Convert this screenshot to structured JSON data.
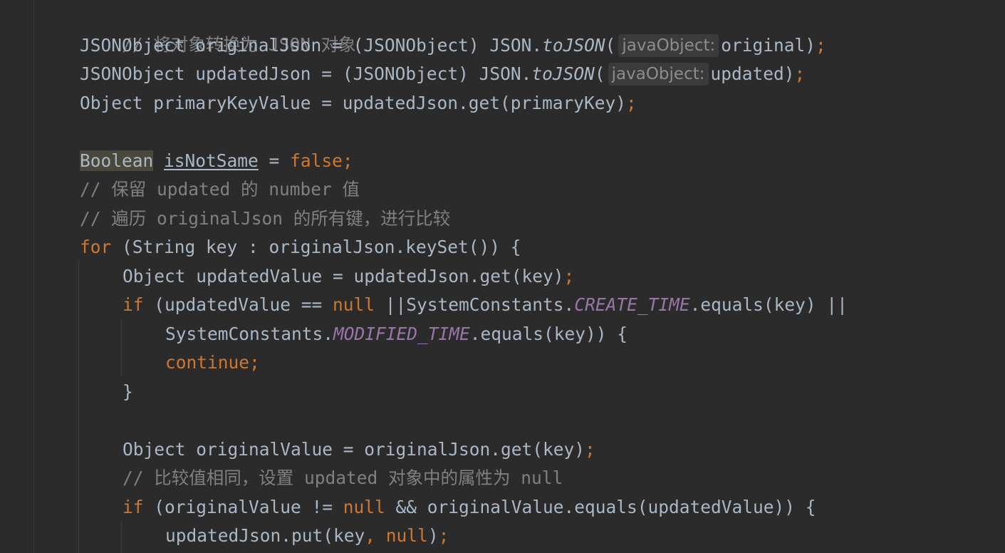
{
  "code": {
    "c1": "// 将对象转换为 JSON 对象",
    "l2": {
      "type": "JSONObject",
      "var": "originalJson",
      "eq": " = ",
      "cast": "(JSONObject)",
      "cls": "JSON.",
      "method": "toJSON",
      "paren": "(",
      "hint": "javaObject:",
      "arg": "original)",
      "semi": ";"
    },
    "l3": {
      "type": "JSONObject",
      "var": "updatedJson",
      "eq": " = ",
      "cast": "(JSONObject)",
      "cls": "JSON.",
      "method": "toJSON",
      "paren": "(",
      "hint": "javaObject:",
      "arg": "updated)",
      "semi": ";"
    },
    "l4": {
      "text": "Object primaryKeyValue = updatedJson.get(primaryKey)",
      "semi": ";"
    },
    "l6": {
      "type": "Boolean",
      "var": "isNotSame",
      "eq": " = ",
      "value": "false",
      "semi": ";"
    },
    "c7": "// 保留 updated 的 number 值",
    "c8": "// 遍历 originalJson 的所有键，进行比较",
    "l9": {
      "kw": "for",
      "rest": " (String key : originalJson.keySet()) {"
    },
    "l10": {
      "text": "Object updatedValue = updatedJson.get(key)",
      "semi": ";"
    },
    "l11": {
      "kw": "if",
      "a": " (updatedValue == ",
      "null": "null",
      "b": " ||SystemConstants.",
      "const": "CREATE_TIME",
      "c": ".equals(key) ||"
    },
    "l12": {
      "a": "SystemConstants.",
      "const": "MODIFIED_TIME",
      "b": ".equals(key)) {"
    },
    "l13": {
      "kw": "continue",
      "semi": ";"
    },
    "l14": "}",
    "l16": {
      "text": "Object originalValue = originalJson.get(key)",
      "semi": ";"
    },
    "c17": "// 比较值相同，设置 updated 对象中的属性为 null",
    "l18": {
      "kw": "if",
      "a": " (originalValue != ",
      "null": "null",
      "b": " && originalValue.equals(updatedValue)) {"
    },
    "l19": {
      "a": "updatedJson.put(key",
      "comma": ",",
      "sp": " ",
      "null": "null",
      "b": ")",
      "semi": ";"
    }
  },
  "colors": {
    "background": "#2b2b2b",
    "text": "#a9b7c6",
    "keyword": "#cc7832",
    "comment": "#808080",
    "constant": "#9876aa"
  }
}
